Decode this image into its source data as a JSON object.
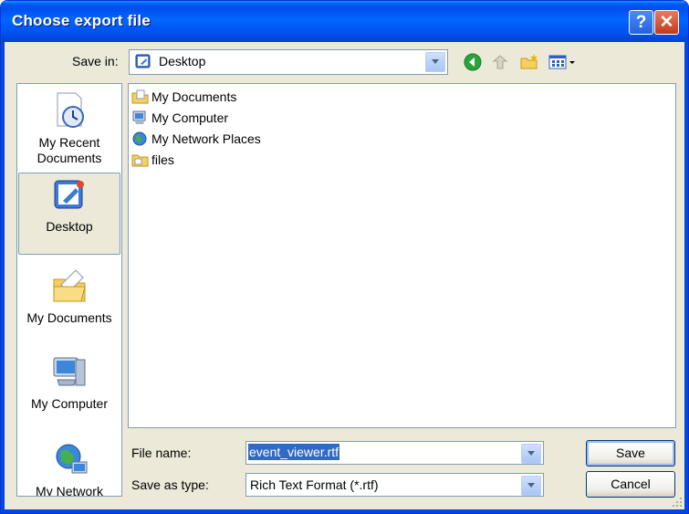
{
  "window": {
    "title": "Choose export file"
  },
  "toolbar": {
    "save_in_label": "Save in:",
    "save_in_value": "Desktop",
    "icons": [
      "back-icon",
      "up-folder-icon",
      "new-folder-icon",
      "views-menu-icon"
    ]
  },
  "places": [
    {
      "label": "My Recent Documents",
      "icon": "recent-documents-icon"
    },
    {
      "label": "Desktop",
      "icon": "desktop-icon",
      "selected": true
    },
    {
      "label": "My Documents",
      "icon": "my-documents-icon"
    },
    {
      "label": "My Computer",
      "icon": "my-computer-icon"
    },
    {
      "label": "My Network",
      "icon": "my-network-icon"
    }
  ],
  "files": [
    {
      "name": "My Documents",
      "icon": "my-documents-icon"
    },
    {
      "name": "My Computer",
      "icon": "my-computer-icon"
    },
    {
      "name": "My Network Places",
      "icon": "network-places-icon"
    },
    {
      "name": "files",
      "icon": "folder-icon"
    }
  ],
  "form": {
    "file_name_label": "File name:",
    "file_name_value": "event_viewer.rtf",
    "save_type_label": "Save as type:",
    "save_type_value": "Rich Text Format (*.rtf)"
  },
  "buttons": {
    "save": "Save",
    "cancel": "Cancel"
  },
  "colors": {
    "titlebar": "#0053ee",
    "selection": "#316ac5",
    "dialog_bg": "#ece9d8"
  }
}
